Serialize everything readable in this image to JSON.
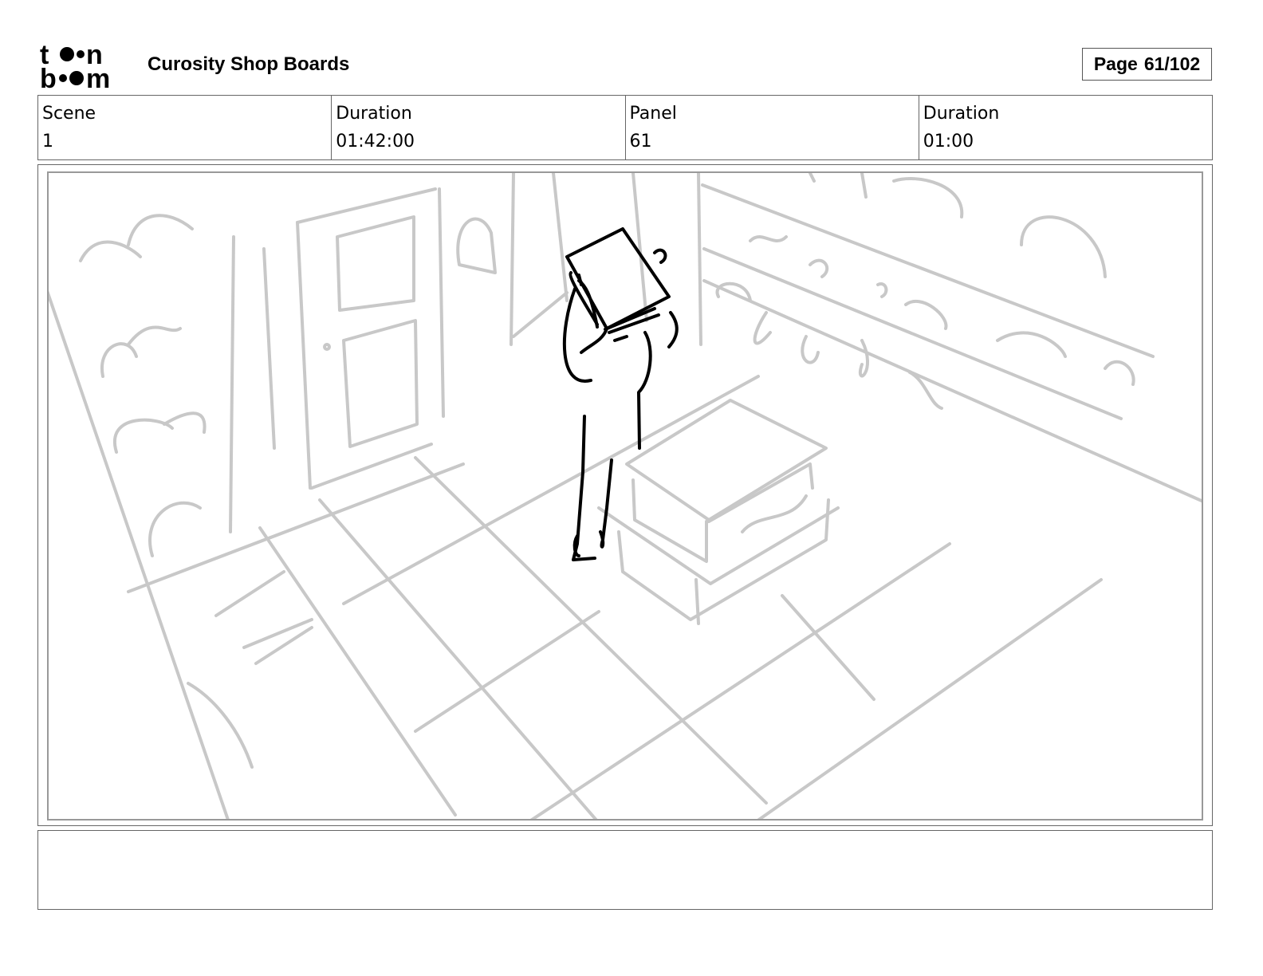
{
  "header": {
    "logo_text_top": "toon",
    "logo_text_bottom": "boom",
    "project_title": "Curosity Shop Boards",
    "page_label": "Page",
    "page_value": "61/102"
  },
  "info": [
    {
      "label": "Scene",
      "value": "1"
    },
    {
      "label": "Duration",
      "value": "01:42:00"
    },
    {
      "label": "Panel",
      "value": "61"
    },
    {
      "label": "Duration",
      "value": "01:00"
    }
  ],
  "panel": {
    "icon": "storyboard-sketch-image",
    "sketch_colors": {
      "background_lines": "#c8c8c8",
      "character_lines": "#000000"
    }
  },
  "notes": {
    "text": ""
  }
}
